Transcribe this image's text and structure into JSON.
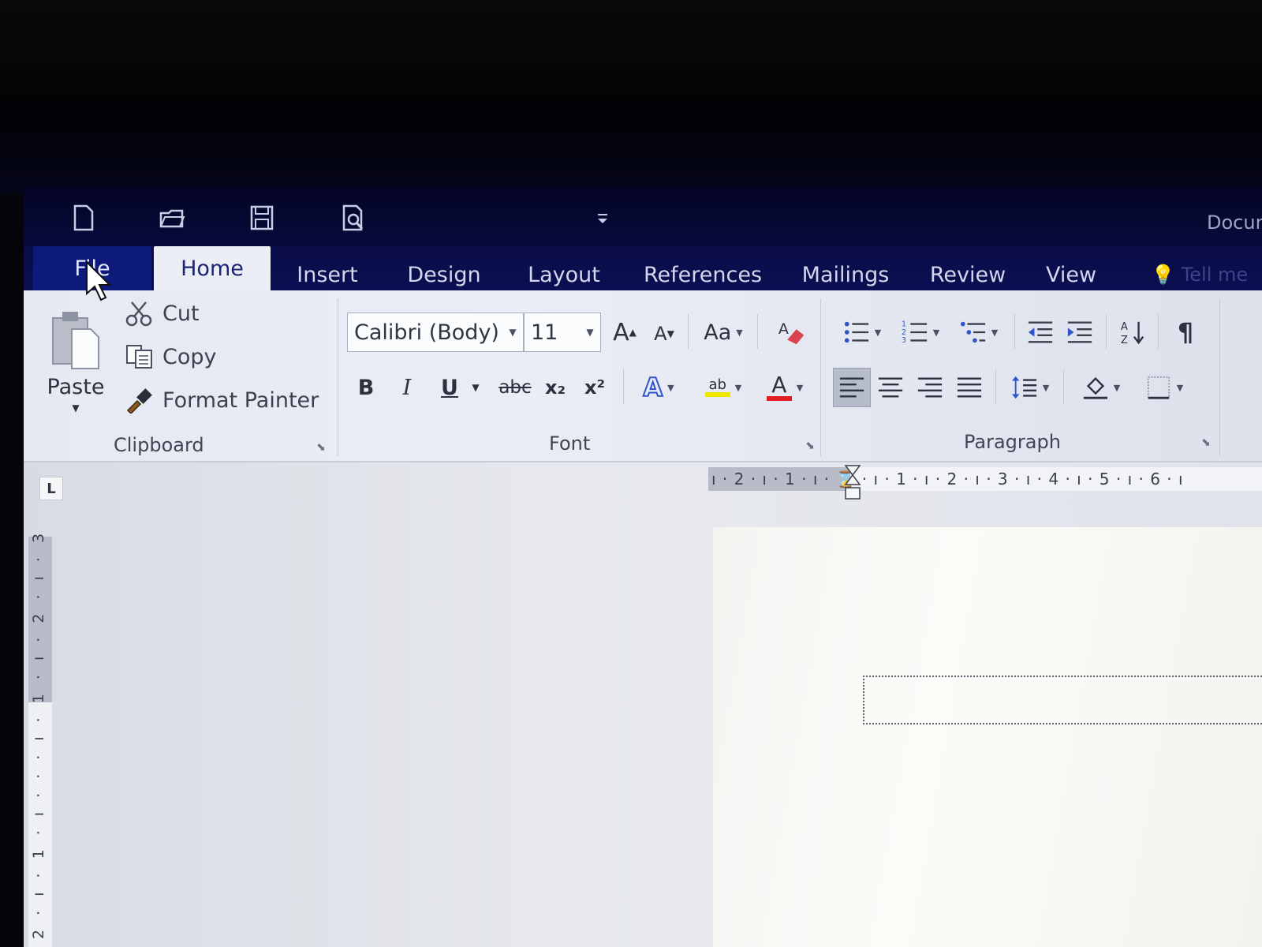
{
  "window": {
    "title": "Docun",
    "quick_access": [
      {
        "name": "new-document-icon"
      },
      {
        "name": "open-folder-icon"
      },
      {
        "name": "save-icon"
      },
      {
        "name": "print-preview-icon"
      },
      {
        "name": "customize-toolbar-icon"
      }
    ]
  },
  "tabs": [
    {
      "label": "File",
      "active": false
    },
    {
      "label": "Home",
      "active": true
    },
    {
      "label": "Insert",
      "active": false
    },
    {
      "label": "Design",
      "active": false
    },
    {
      "label": "Layout",
      "active": false
    },
    {
      "label": "References",
      "active": false
    },
    {
      "label": "Mailings",
      "active": false
    },
    {
      "label": "Review",
      "active": false
    },
    {
      "label": "View",
      "active": false
    }
  ],
  "tell_me": "Tell me",
  "clipboard": {
    "group_label": "Clipboard",
    "paste": "Paste",
    "cut": "Cut",
    "copy": "Copy",
    "format_painter": "Format Painter"
  },
  "font": {
    "group_label": "Font",
    "font_name": "Calibri (Body)",
    "font_size": "11",
    "change_case": "Aa",
    "bold": "B",
    "italic": "I",
    "underline": "U",
    "strikethrough": "abc",
    "subscript": "x₂",
    "superscript": "x²",
    "text_effects": "A",
    "highlight": "ab",
    "font_color": "A",
    "grow": "A",
    "shrink": "A",
    "font_color_swatch": "#e02020",
    "highlight_swatch": "#f2e600"
  },
  "paragraph": {
    "group_label": "Paragraph",
    "show_marks": "¶",
    "alignment_active": "left"
  },
  "ruler": {
    "horizontal": "ı · 2 · ı · 1 · ı · ⌛ · ı · 1 · ı · 2 · ı · 3 · ı · 4 · ı · 5 · ı · 6 · ı",
    "vertical": "2 · ı · 1 · ı · · · ı · 1 · ı · 2 · ı · 3",
    "tab_selector": "L"
  },
  "accent_color": "#0c1054"
}
